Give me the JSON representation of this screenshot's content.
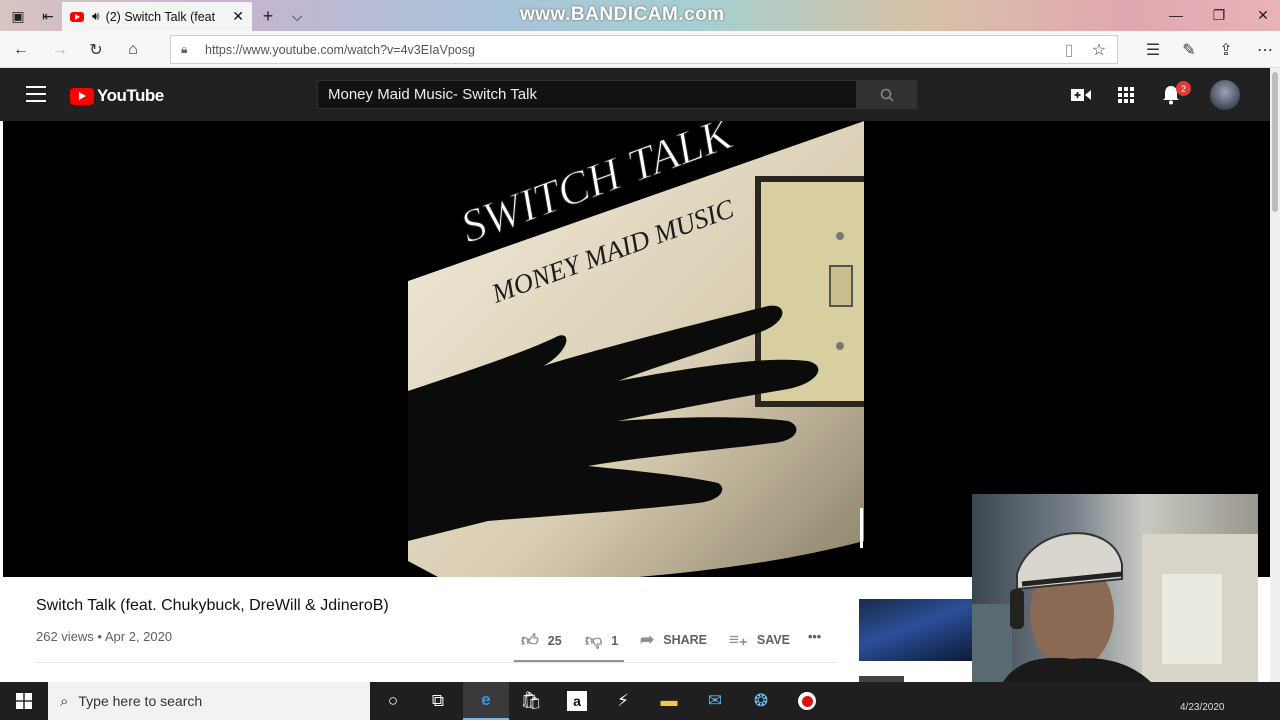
{
  "browser": {
    "tab_title": "(2) Switch Talk (feat",
    "tab_close": "✕",
    "new_tab": "+",
    "tab_dropdown": "⌵",
    "watermark": "www.BANDICAM.com",
    "url": "https://www.youtube.com/watch?v=4v3EIaVposg"
  },
  "youtube": {
    "logo_text": "YouTube",
    "search_value": "Money Maid Music- Switch Talk",
    "notifications_count": "2"
  },
  "artwork": {
    "title": "SWITCH TALK",
    "artist": "MONEY MAID MUSIC"
  },
  "video": {
    "title": "Switch Talk (feat. Chukybuck, DreWill & JdineroB)",
    "meta": "262 views • Apr 2, 2020",
    "likes": "25",
    "dislikes": "1",
    "share_label": "SHARE",
    "save_label": "SAVE",
    "more_label": "•••"
  },
  "taskbar": {
    "search_placeholder": "Type here to search",
    "clock_date": "4/23/2020"
  },
  "colors": {
    "yt_red": "#ff0000",
    "yt_header": "#212121",
    "taskbar": "#1f1f1f"
  }
}
